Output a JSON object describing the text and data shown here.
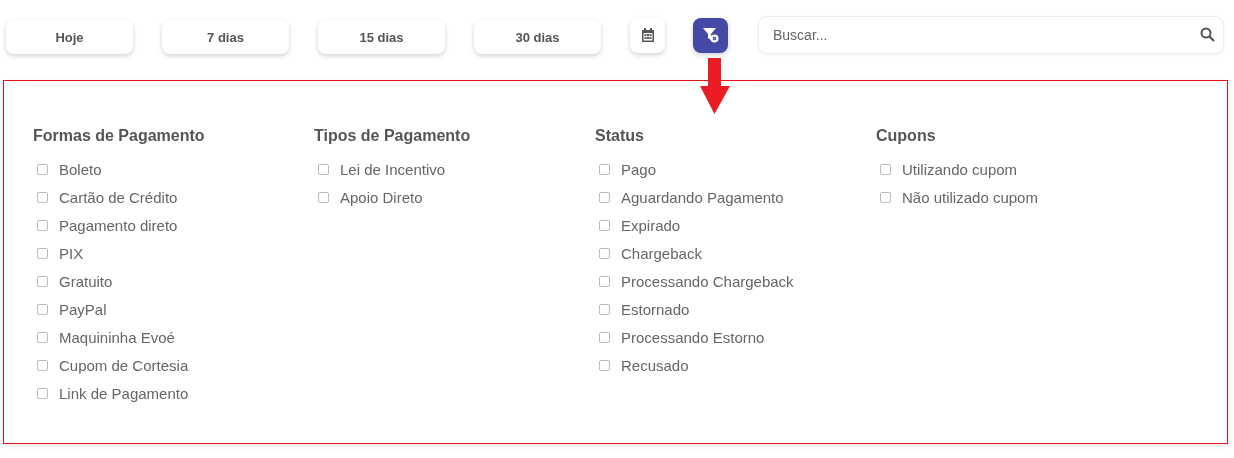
{
  "period_buttons": [
    {
      "label": "Hoje",
      "selected": false
    },
    {
      "label": "7 dias",
      "selected": false
    },
    {
      "label": "15 dias",
      "selected": false
    },
    {
      "label": "30 dias",
      "selected": false
    }
  ],
  "filter_button": {
    "active": true
  },
  "search": {
    "placeholder": "Buscar..."
  },
  "filter_groups": [
    {
      "title": "Formas de Pagamento",
      "options": [
        {
          "label": "Boleto",
          "checked": false
        },
        {
          "label": "Cartão de Crédito",
          "checked": false
        },
        {
          "label": "Pagamento direto",
          "checked": false
        },
        {
          "label": "PIX",
          "checked": false
        },
        {
          "label": "Gratuito",
          "checked": false
        },
        {
          "label": "PayPal",
          "checked": false
        },
        {
          "label": "Maquininha Evoé",
          "checked": false
        },
        {
          "label": "Cupom de Cortesia",
          "checked": false
        },
        {
          "label": "Link de Pagamento",
          "checked": false
        }
      ]
    },
    {
      "title": "Tipos de Pagamento",
      "options": [
        {
          "label": "Lei de Incentivo",
          "checked": false
        },
        {
          "label": "Apoio Direto",
          "checked": false
        }
      ]
    },
    {
      "title": "Status",
      "options": [
        {
          "label": "Pago",
          "checked": false
        },
        {
          "label": "Aguardando Pagamento",
          "checked": false
        },
        {
          "label": "Expirado",
          "checked": false
        },
        {
          "label": "Chargeback",
          "checked": false
        },
        {
          "label": "Processando Chargeback",
          "checked": false
        },
        {
          "label": "Estornado",
          "checked": false
        },
        {
          "label": "Processando Estorno",
          "checked": false
        },
        {
          "label": "Recusado",
          "checked": false
        }
      ]
    },
    {
      "title": "Cupons",
      "options": [
        {
          "label": "Utilizando cupom",
          "checked": false
        },
        {
          "label": "Não utilizado cupom",
          "checked": false
        }
      ]
    }
  ]
}
